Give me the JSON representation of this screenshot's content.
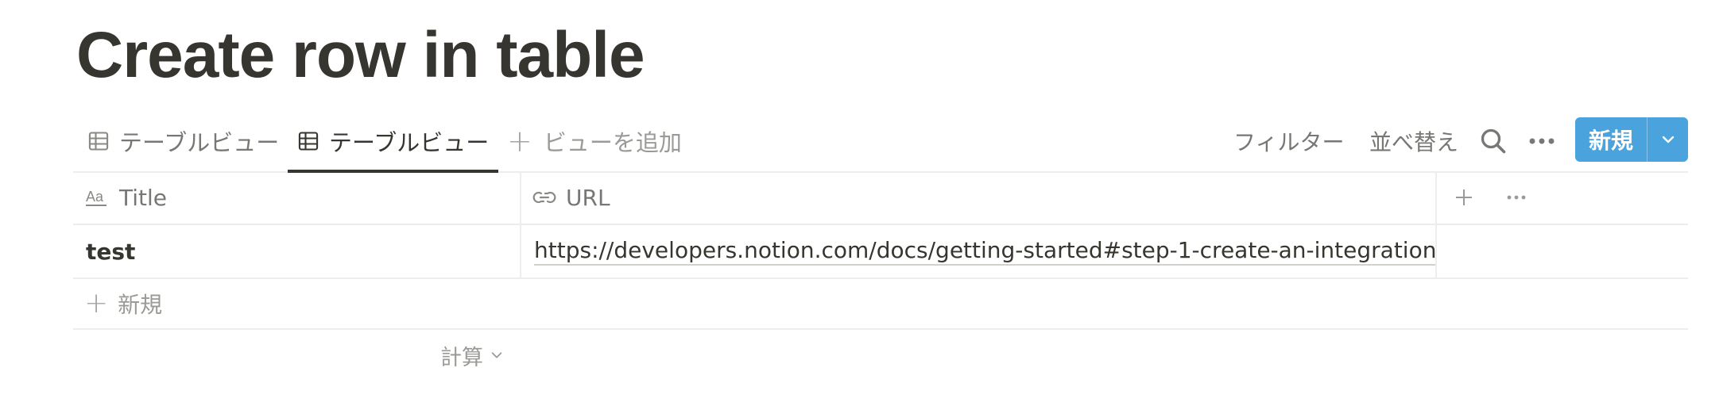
{
  "page": {
    "title": "Create row in table"
  },
  "views": {
    "tabs": [
      {
        "label": "テーブルビュー",
        "icon": "table-icon",
        "active": false
      },
      {
        "label": "テーブルビュー",
        "icon": "table-icon",
        "active": true
      }
    ],
    "add_view_label": "ビューを追加"
  },
  "toolbar": {
    "filter_label": "フィルター",
    "sort_label": "並べ替え",
    "search_icon": "search-icon",
    "more_icon": "more-horizontal-icon",
    "new_label": "新規",
    "new_dropdown_icon": "chevron-down-icon"
  },
  "table": {
    "columns": [
      {
        "label": "Title",
        "icon": "text-aa-icon"
      },
      {
        "label": "URL",
        "icon": "link-icon"
      }
    ],
    "rows": [
      {
        "title": "test",
        "url": "https://developers.notion.com/docs/getting-started#step-1-create-an-integration"
      }
    ],
    "new_row_label": "新規",
    "calculate_label": "計算"
  },
  "colors": {
    "accent": "#4aa3dd",
    "text": "#37352f",
    "muted": "#787774",
    "border": "#ededec"
  }
}
